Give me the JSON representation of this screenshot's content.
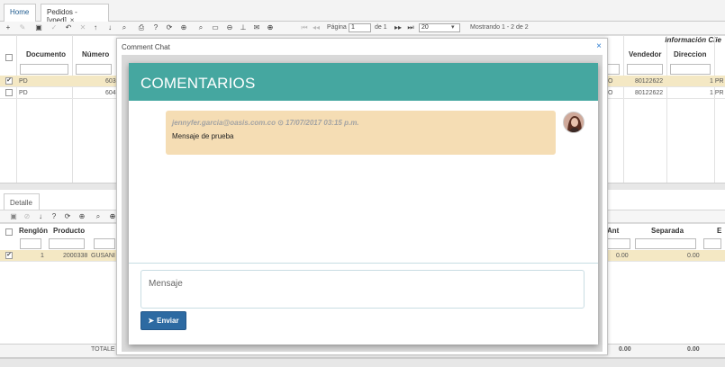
{
  "tabs": [
    {
      "label": "Home"
    },
    {
      "label": "Pedidos -[vped]",
      "close": "×"
    }
  ],
  "toolbar": {
    "page_label": "Página",
    "page_value": "1",
    "page_of": "de 1",
    "page_size": "20",
    "showing": "Mostrando 1 - 2 de 2"
  },
  "top_grid": {
    "group_header": "Información Clie",
    "columns_left": [
      "Documento",
      "Número"
    ],
    "columns_right": [
      "Vendedor",
      "Direccion"
    ],
    "rows": [
      {
        "doc": "PD",
        "num": "603",
        "o": "O",
        "vendedor": "80122622",
        "dir": "1 PR",
        "selected": true
      },
      {
        "doc": "PD",
        "num": "604",
        "o": "O",
        "vendedor": "80122622",
        "dir": "1 PR",
        "selected": false
      }
    ]
  },
  "detail": {
    "tab_label": "Detalle",
    "columns_left": [
      "Renglón",
      "Producto"
    ],
    "columns_right": [
      "Ant",
      "Separada",
      "E"
    ],
    "rows": [
      {
        "renglon": "1",
        "producto": "2000338",
        "desc": "GUSANI",
        "ant": "0.00",
        "separada": "0.00",
        "selected": true
      }
    ],
    "footer_label": "TOTALE",
    "footer_values": [
      "0.00",
      "0.00"
    ]
  },
  "dialog": {
    "title": "Comment Chat",
    "close": "×",
    "header": "COMENTARIOS",
    "messages": [
      {
        "author": "jennyfer.garcia@oasis.com.co",
        "timestamp": "17/07/2017 03:15 p.m.",
        "text": "Mensaje de prueba"
      }
    ],
    "input_placeholder": "Mensaje",
    "send_label": "Enviar"
  },
  "colors": {
    "header_teal": "#45a7a0",
    "bubble": "#f5ddb4",
    "send_button": "#2d6aa2",
    "selected_row": "#f4e8c4"
  },
  "icons": [
    "add-icon",
    "edit-icon",
    "save-icon",
    "check-icon",
    "undo-icon",
    "delete-icon",
    "up-arrow-icon",
    "down-arrow-icon",
    "search-icon",
    "print-icon",
    "help-icon",
    "refresh-icon",
    "zoom-icon",
    "filter-icon",
    "comment-icon",
    "pin-icon",
    "mail-icon",
    "plus-circle-icon",
    "paper-plane-icon",
    "clock-icon",
    "close-icon"
  ]
}
